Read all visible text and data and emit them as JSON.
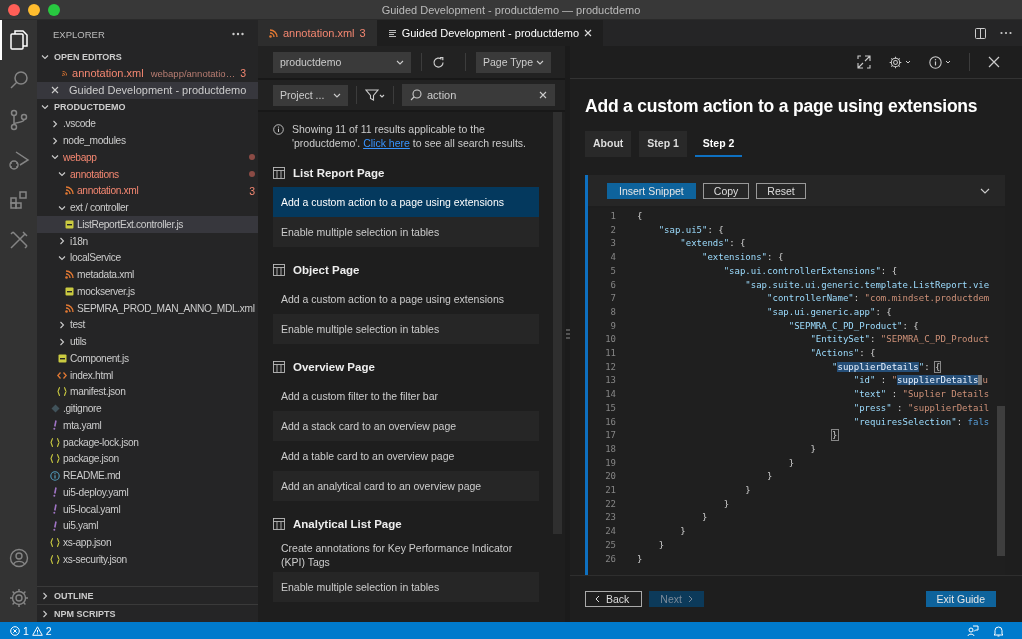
{
  "window": {
    "title": "Guided Development - productdemo — productdemo"
  },
  "activity_bar": {
    "items": [
      {
        "kind": "explorer",
        "selected": true
      },
      {
        "kind": "search",
        "selected": false
      },
      {
        "kind": "source-control",
        "selected": false
      },
      {
        "kind": "run",
        "selected": false
      },
      {
        "kind": "extensions",
        "selected": false
      },
      {
        "kind": "tools",
        "selected": false
      }
    ],
    "bottom": [
      {
        "kind": "account"
      },
      {
        "kind": "settings"
      }
    ]
  },
  "sidebar": {
    "title": "EXPLORER",
    "open_editors": {
      "title": "OPEN EDITORS",
      "expanded": true,
      "items": [
        {
          "kind": "xml",
          "name": "annotation.xml",
          "path": "webapp/annotatio…",
          "problems": "3",
          "error": true,
          "selected": false
        },
        {
          "kind": "guide",
          "name": "Guided Development - productdemo",
          "error": false,
          "selected": true
        }
      ]
    },
    "project": {
      "title": "PRODUCTDEMO",
      "expanded": true,
      "tree": [
        {
          "kind": "folder",
          "name": ".vscode",
          "expanded": false,
          "error": false,
          "selected": false
        },
        {
          "kind": "folder",
          "name": "node_modules",
          "expanded": false,
          "error": false,
          "selected": false
        },
        {
          "kind": "folder",
          "name": "webapp",
          "expanded": true,
          "error": true,
          "selected": false,
          "children": [
            {
              "kind": "folder",
              "name": "annotations",
              "expanded": true,
              "error": true,
              "selected": false,
              "children": [
                {
                  "kind": "xml",
                  "name": "annotation.xml",
                  "problems": "3",
                  "error": true,
                  "selected": false
                }
              ]
            },
            {
              "kind": "folder",
              "name": "ext / controller",
              "expanded": true,
              "error": false,
              "selected": false,
              "children": [
                {
                  "kind": "js",
                  "name": "ListReportExt.controller.js",
                  "error": false,
                  "selected": true
                }
              ]
            },
            {
              "kind": "folder",
              "name": "i18n",
              "expanded": false,
              "error": false,
              "selected": false
            },
            {
              "kind": "folder",
              "name": "localService",
              "expanded": true,
              "error": false,
              "selected": false,
              "children": [
                {
                  "kind": "xml",
                  "name": "metadata.xml",
                  "error": false,
                  "selected": false
                },
                {
                  "kind": "js",
                  "name": "mockserver.js",
                  "error": false,
                  "selected": false
                },
                {
                  "kind": "xml",
                  "name": "SEPMRA_PROD_MAN_ANNO_MDL.xml",
                  "error": false,
                  "selected": false
                }
              ]
            },
            {
              "kind": "folder",
              "name": "test",
              "expanded": false,
              "error": false,
              "selected": false
            },
            {
              "kind": "folder",
              "name": "utils",
              "expanded": false,
              "error": false,
              "selected": false
            },
            {
              "kind": "js",
              "name": "Component.js",
              "error": false,
              "selected": false
            },
            {
              "kind": "html",
              "name": "index.html",
              "error": false,
              "selected": false
            },
            {
              "kind": "json",
              "name": "manifest.json",
              "error": false,
              "selected": false
            }
          ]
        },
        {
          "kind": "git",
          "name": ".gitignore",
          "error": false,
          "selected": false
        },
        {
          "kind": "yaml",
          "name": "mta.yaml",
          "error": false,
          "selected": false
        },
        {
          "kind": "json",
          "name": "package-lock.json",
          "error": false,
          "selected": false
        },
        {
          "kind": "json",
          "name": "package.json",
          "error": false,
          "selected": false
        },
        {
          "kind": "md",
          "name": "README.md",
          "error": false,
          "selected": false
        },
        {
          "kind": "yaml",
          "name": "ui5-deploy.yaml",
          "error": false,
          "selected": false
        },
        {
          "kind": "yaml",
          "name": "ui5-local.yaml",
          "error": false,
          "selected": false
        },
        {
          "kind": "yaml",
          "name": "ui5.yaml",
          "error": false,
          "selected": false
        },
        {
          "kind": "json",
          "name": "xs-app.json",
          "error": false,
          "selected": false
        },
        {
          "kind": "json",
          "name": "xs-security.json",
          "error": false,
          "selected": false
        }
      ]
    },
    "sections": [
      {
        "title": "OUTLINE",
        "expanded": false
      },
      {
        "title": "NPM SCRIPTS",
        "expanded": false
      }
    ]
  },
  "editor_tabs": [
    {
      "kind": "xml",
      "label": "annotation.xml",
      "problems": "3",
      "error": true,
      "selected": false
    },
    {
      "kind": "guide",
      "label": "Guided Development - productdemo",
      "error": false,
      "selected": true
    }
  ],
  "guide_list": {
    "project_select": "productdemo",
    "page_type_select": "Page Type",
    "project_filter": "Project ...",
    "search": {
      "value": "action"
    },
    "notice": {
      "text": "Showing 11 of 11 results applicable to the 'productdemo'.",
      "link": "Click here",
      "after": "to see all search results."
    },
    "groups": [
      {
        "title": "List Report Page",
        "items": [
          {
            "label": "Add a custom action to a page using extensions",
            "selected": true
          },
          {
            "label": "Enable multiple selection in tables",
            "selected": false
          }
        ]
      },
      {
        "title": "Object Page",
        "items": [
          {
            "label": "Add a custom action to a page using extensions",
            "selected": false
          },
          {
            "label": "Enable multiple selection in tables",
            "selected": false
          }
        ]
      },
      {
        "title": "Overview Page",
        "items": [
          {
            "label": "Add a custom filter to the filter bar",
            "selected": false
          },
          {
            "label": "Add a stack card to an overview page",
            "selected": false
          },
          {
            "label": "Add a table card to an overview page",
            "selected": false
          },
          {
            "label": "Add an analytical card to an overview page",
            "selected": false
          }
        ]
      },
      {
        "title": "Analytical List Page",
        "items": [
          {
            "label": "Create annotations for Key Performance Indicator (KPI) Tags",
            "selected": false
          },
          {
            "label": "Enable multiple selection in tables",
            "selected": false
          }
        ]
      }
    ]
  },
  "guide_detail": {
    "title": "Add a custom action to a page using extensions",
    "tabs": [
      {
        "label": "About",
        "selected": false
      },
      {
        "label": "Step 1",
        "selected": false
      },
      {
        "label": "Step 2",
        "selected": true
      }
    ],
    "snippet": {
      "expanded": true,
      "buttons": [
        {
          "kind": "primary",
          "label": "Insert Snippet"
        },
        {
          "kind": "outline",
          "label": "Copy"
        },
        {
          "kind": "outline",
          "label": "Reset"
        }
      ],
      "lines": [
        {
          "number": "1",
          "segments": [
            {
              "kind": "punct",
              "text": "{"
            }
          ]
        },
        {
          "number": "2",
          "segments": [
            {
              "kind": "key",
              "text": "    \"sap.ui5\""
            },
            {
              "kind": "punct",
              "text": ": {"
            }
          ]
        },
        {
          "number": "3",
          "segments": [
            {
              "kind": "key",
              "text": "        \"extends\""
            },
            {
              "kind": "punct",
              "text": ": {"
            }
          ]
        },
        {
          "number": "4",
          "segments": [
            {
              "kind": "key",
              "text": "            \"extensions\""
            },
            {
              "kind": "punct",
              "text": ": {"
            }
          ]
        },
        {
          "number": "5",
          "segments": [
            {
              "kind": "key",
              "text": "                \"sap.ui.controllerExtensions\""
            },
            {
              "kind": "punct",
              "text": ": {"
            }
          ]
        },
        {
          "number": "6",
          "segments": [
            {
              "kind": "key",
              "text": "                    \"sap.suite.ui.generic.template.ListReport.vie"
            }
          ]
        },
        {
          "number": "7",
          "segments": [
            {
              "kind": "key",
              "text": "                        \"controllerName\""
            },
            {
              "kind": "punct",
              "text": ": "
            },
            {
              "kind": "string",
              "text": "\"com.mindset.productdem"
            }
          ]
        },
        {
          "number": "8",
          "segments": [
            {
              "kind": "key",
              "text": "                        \"sap.ui.generic.app\""
            },
            {
              "kind": "punct",
              "text": ": {"
            }
          ]
        },
        {
          "number": "9",
          "segments": [
            {
              "kind": "key",
              "text": "                            \"SEPMRA_C_PD_Product\""
            },
            {
              "kind": "punct",
              "text": ": {"
            }
          ]
        },
        {
          "number": "10",
          "segments": [
            {
              "kind": "key",
              "text": "                                \"EntitySet\""
            },
            {
              "kind": "punct",
              "text": ": "
            },
            {
              "kind": "string",
              "text": "\"SEPMRA_C_PD_Product"
            }
          ]
        },
        {
          "number": "11",
          "segments": [
            {
              "kind": "key",
              "text": "                                \"Actions\""
            },
            {
              "kind": "punct",
              "text": ": {"
            }
          ]
        },
        {
          "number": "12",
          "segments": [
            {
              "kind": "key",
              "text": "                                    \""
            },
            {
              "kind": "match",
              "text": "supplierDetails"
            },
            {
              "kind": "key",
              "text": "\""
            },
            {
              "kind": "punct",
              "text": ": "
            },
            {
              "kind": "bracket",
              "text": "{"
            }
          ]
        },
        {
          "number": "13",
          "segments": [
            {
              "kind": "key",
              "text": "                                        \"id\""
            },
            {
              "kind": "punct",
              "text": " : "
            },
            {
              "kind": "string",
              "text": "\""
            },
            {
              "kind": "match",
              "text": "supplierDetails"
            },
            {
              "kind": "cursor",
              "text": "u"
            }
          ]
        },
        {
          "number": "14",
          "segments": [
            {
              "kind": "key",
              "text": "                                        \"text\""
            },
            {
              "kind": "punct",
              "text": " : "
            },
            {
              "kind": "string",
              "text": "\"Suplier Details"
            }
          ]
        },
        {
          "number": "15",
          "segments": [
            {
              "kind": "key",
              "text": "                                        \"press\""
            },
            {
              "kind": "punct",
              "text": " : "
            },
            {
              "kind": "string",
              "text": "\"supplierDetail"
            }
          ]
        },
        {
          "number": "16",
          "segments": [
            {
              "kind": "key",
              "text": "                                        \"requiresSelection\""
            },
            {
              "kind": "punct",
              "text": ": "
            },
            {
              "kind": "keyword",
              "text": "fals"
            }
          ]
        },
        {
          "number": "17",
          "segments": [
            {
              "kind": "bracket",
              "text": "                                    }"
            }
          ]
        },
        {
          "number": "18",
          "segments": [
            {
              "kind": "punct",
              "text": "                                }"
            }
          ]
        },
        {
          "number": "19",
          "segments": [
            {
              "kind": "punct",
              "text": "                            }"
            }
          ]
        },
        {
          "number": "20",
          "segments": [
            {
              "kind": "punct",
              "text": "                        }"
            }
          ]
        },
        {
          "number": "21",
          "segments": [
            {
              "kind": "punct",
              "text": "                    }"
            }
          ]
        },
        {
          "number": "22",
          "segments": [
            {
              "kind": "punct",
              "text": "                }"
            }
          ]
        },
        {
          "number": "23",
          "segments": [
            {
              "kind": "punct",
              "text": "            }"
            }
          ]
        },
        {
          "number": "24",
          "segments": [
            {
              "kind": "punct",
              "text": "        }"
            }
          ]
        },
        {
          "number": "25",
          "segments": [
            {
              "kind": "punct",
              "text": "    }"
            }
          ]
        },
        {
          "number": "26",
          "segments": [
            {
              "kind": "punct",
              "text": "}"
            }
          ]
        }
      ]
    },
    "footer": {
      "back": {
        "label": "Back",
        "disabled": false
      },
      "next": {
        "label": "Next",
        "disabled": true
      },
      "exit": {
        "label": "Exit Guide"
      }
    }
  },
  "status_bar": {
    "errors": "1",
    "warnings": "2"
  }
}
